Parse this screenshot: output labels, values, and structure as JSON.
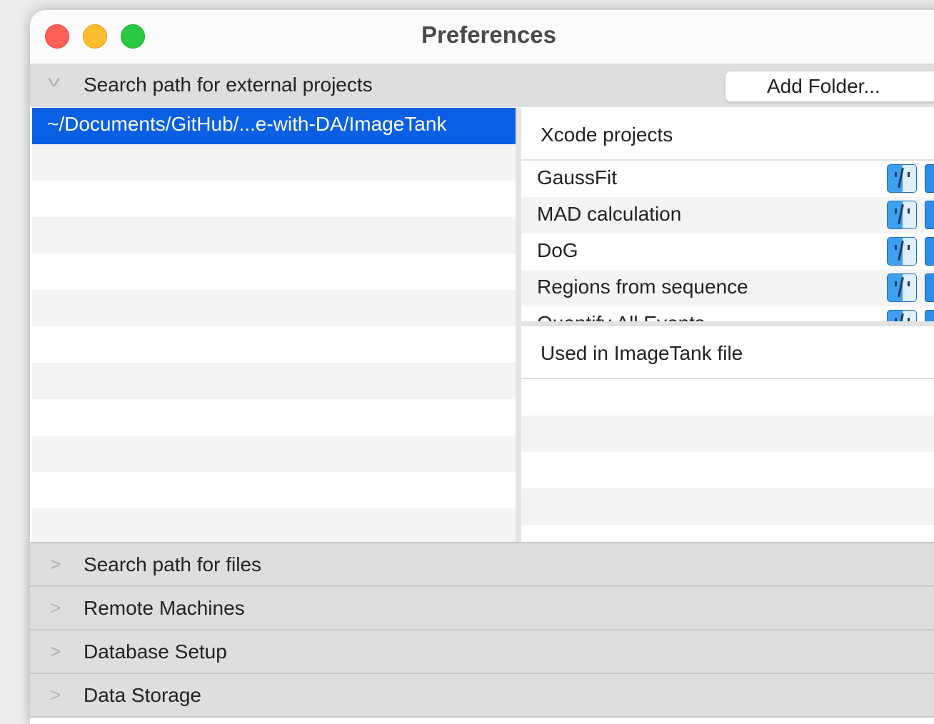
{
  "window": {
    "title": "Preferences"
  },
  "external_projects": {
    "header": "Search path for external projects",
    "add_button": "Add Folder...",
    "paths": [
      "~/Documents/GitHub/...e-with-DA/ImageTank"
    ],
    "projects_header": "Xcode projects",
    "projects": [
      "GaussFit",
      "MAD calculation",
      "DoG",
      "Regions from sequence",
      "Quantify All Events"
    ],
    "used_header": "Used in ImageTank file"
  },
  "sections": [
    {
      "label": "Search path for files",
      "expanded": false
    },
    {
      "label": "Remote Machines",
      "expanded": false
    },
    {
      "label": "Database Setup",
      "expanded": false
    },
    {
      "label": "Data Storage",
      "expanded": false
    }
  ],
  "icons": {
    "expanded": "chevron-down-icon",
    "collapsed": "chevron-right-icon",
    "project_open": "finder-icon",
    "project_xcode": "xcode-icon"
  },
  "colors": {
    "selection": "#0a5fe3",
    "close": "#fe5f57",
    "minimize": "#febc2e",
    "zoom": "#28c840"
  }
}
